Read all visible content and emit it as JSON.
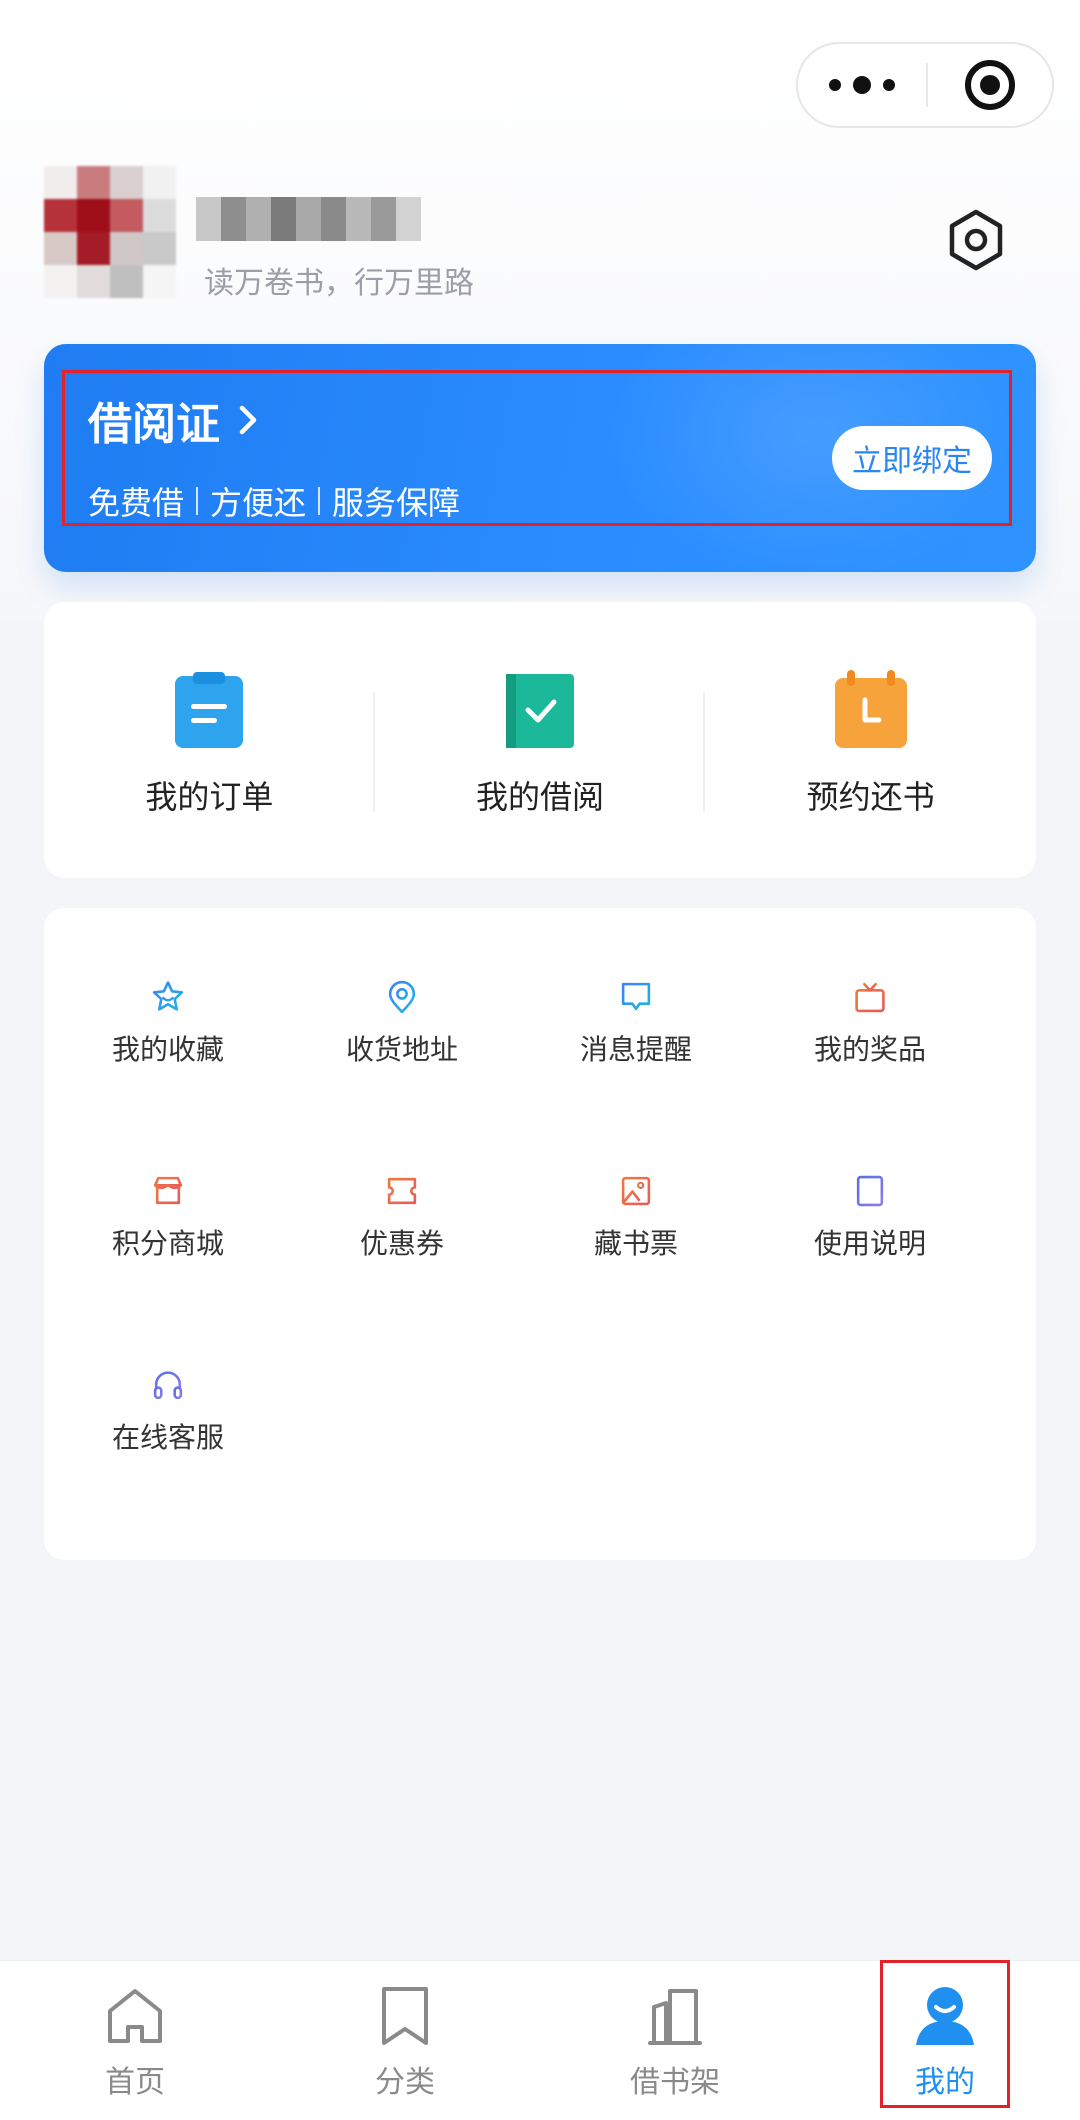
{
  "profile": {
    "nickname": "",
    "motto": "读万卷书，行万里路"
  },
  "card": {
    "title": "借阅证",
    "benefits": [
      "免费借",
      "方便还",
      "服务保障"
    ],
    "bind_button": "立即绑定"
  },
  "quick_actions": [
    {
      "label": "我的订单",
      "icon": "order-icon",
      "color": "#2ea4ef"
    },
    {
      "label": "我的借阅",
      "icon": "borrow-check-icon",
      "color": "#1bb99a"
    },
    {
      "label": "预约还书",
      "icon": "calendar-clock-icon",
      "color": "#f7a33b"
    }
  ],
  "services": [
    {
      "label": "我的收藏",
      "icon": "star-icon"
    },
    {
      "label": "收货地址",
      "icon": "location-pin-icon"
    },
    {
      "label": "消息提醒",
      "icon": "message-icon"
    },
    {
      "label": "我的奖品",
      "icon": "gift-icon"
    },
    {
      "label": "积分商城",
      "icon": "shop-icon"
    },
    {
      "label": "优惠券",
      "icon": "coupon-icon"
    },
    {
      "label": "藏书票",
      "icon": "image-icon"
    },
    {
      "label": "使用说明",
      "icon": "document-icon"
    },
    {
      "label": "在线客服",
      "icon": "headset-icon"
    }
  ],
  "tabbar": {
    "items": [
      {
        "label": "首页",
        "icon": "home-icon"
      },
      {
        "label": "分类",
        "icon": "bookmark-icon"
      },
      {
        "label": "借书架",
        "icon": "bookshelf-icon"
      },
      {
        "label": "我的",
        "icon": "user-icon"
      }
    ],
    "active": "我的"
  },
  "colors": {
    "brand_blue": "#2a86f5",
    "tab_active": "#1f8ff0",
    "highlight_outline": "#e3212a"
  }
}
